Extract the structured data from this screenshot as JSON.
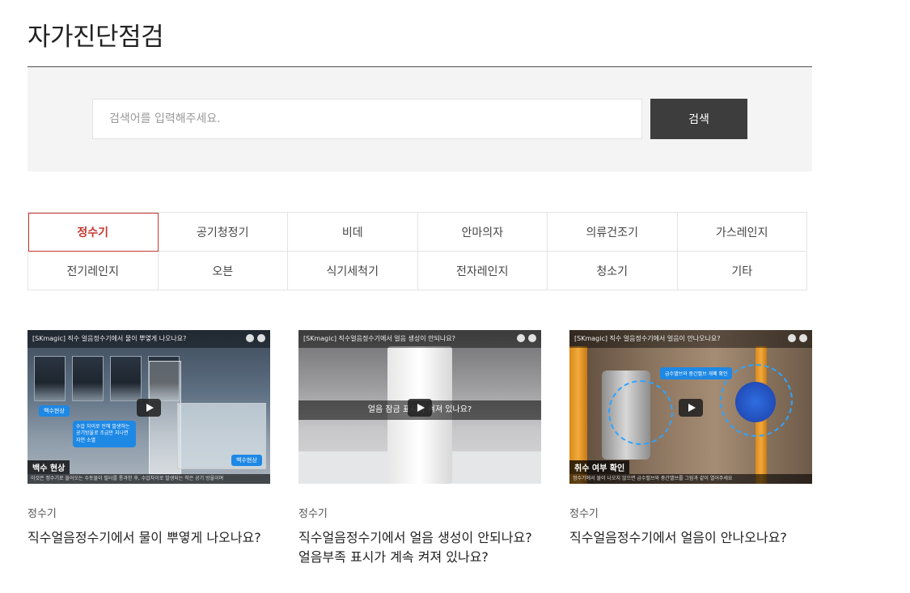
{
  "page": {
    "title": "자가진단점검"
  },
  "search": {
    "placeholder": "검색어를 입력해주세요.",
    "button_label": "검색"
  },
  "categories": [
    {
      "label": "정수기",
      "active": true
    },
    {
      "label": "공기청정기",
      "active": false
    },
    {
      "label": "비데",
      "active": false
    },
    {
      "label": "안마의자",
      "active": false
    },
    {
      "label": "의류건조기",
      "active": false
    },
    {
      "label": "가스레인지",
      "active": false
    },
    {
      "label": "전기레인지",
      "active": false
    },
    {
      "label": "오븐",
      "active": false
    },
    {
      "label": "식기세척기",
      "active": false
    },
    {
      "label": "전자레인지",
      "active": false
    },
    {
      "label": "청소기",
      "active": false
    },
    {
      "label": "기타",
      "active": false
    }
  ],
  "cards": [
    {
      "category": "정수기",
      "title": "직수얼음정수기에서 물이 뿌옇게 나오나요?",
      "video_title": "[SKmagic] 직수 얼음정수기에서 물이 뿌옇게 나오나요?",
      "thumb_tag": "백수현상",
      "thumb_bubble": "수압 차이로 인해 발생하는 공기방울로 조금만 지나면 자연 소멸",
      "thumb_tag2": "백수현상",
      "caption_label": "백수 현상",
      "caption_sub": "이것은 정수기로 들어오는 수돗물이 필터를 통과한 후, 수압차이로 발생되는 작은 공기 방울이며"
    },
    {
      "category": "정수기",
      "title": "직수얼음정수기에서 얼음 생성이 안되나요?얼음부족 표시가 계속 켜져 있나요?",
      "video_title": "[SKmagic] 직수얼음정수기에서 얼음 생성이 안되나요?",
      "overlay_text": "얼음 잠금 표시가 켜져 있나요?"
    },
    {
      "category": "정수기",
      "title": "직수얼음정수기에서 얼음이 안나오나요?",
      "video_title": "[SKmagic] 직수 얼음정수기에서 얼음이 안나오나요?",
      "thumb_bubble": "급수밸브와 중간밸브 개폐 확인",
      "caption_label": "취수 여부 확인",
      "caption_sub": "정수기에서 물이 나오지 않으면 급수밸브와 중간밸브를 그림과 같이 열어주세요"
    }
  ]
}
